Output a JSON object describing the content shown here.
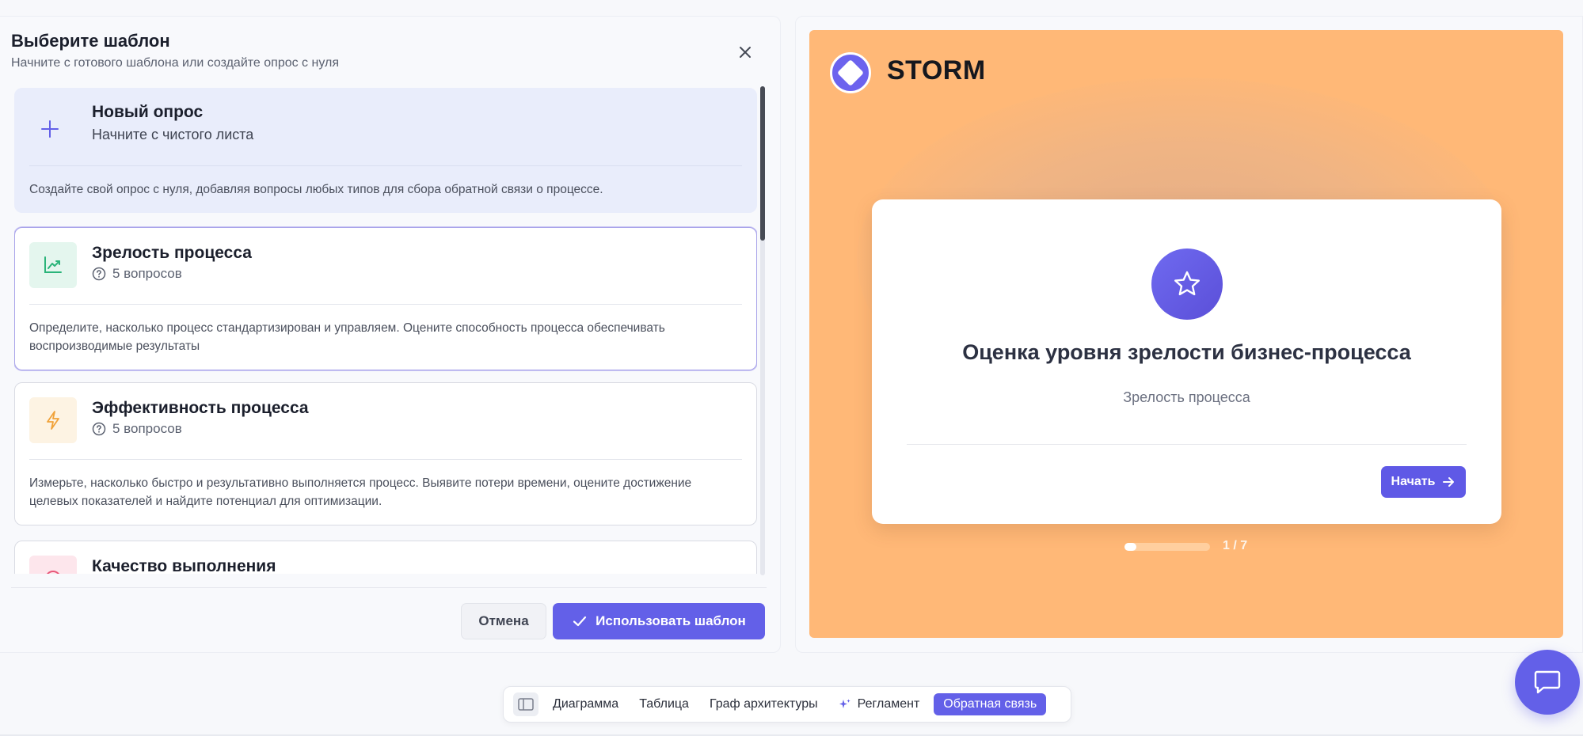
{
  "dialog": {
    "title": "Выберите шаблон",
    "subtitle": "Начните с готового шаблона или создайте опрос с нуля",
    "cancel_label": "Отмена",
    "use_label": "Использовать шаблон"
  },
  "templates": [
    {
      "title": "Новый опрос",
      "subtitle": "Начните с чистого листа",
      "description": "Создайте свой опрос с нуля, добавляя вопросы любых типов для сбора обратной связи о процессе.",
      "icon": "plus-icon"
    },
    {
      "title": "Зрелость процесса",
      "meta": "5 вопросов",
      "description": "Определите, насколько процесс стандартизирован и управляем. Оцените способность процесса обеспечивать воспроизводимые результаты",
      "icon": "trend-chart-icon",
      "selected": true
    },
    {
      "title": "Эффективность процесса",
      "meta": "5 вопросов",
      "description": "Измерьте, насколько быстро и результативно выполняется процесс. Выявите потери времени, оцените достижение целевых показателей и найдите потенциал для оптимизации.",
      "icon": "lightning-icon"
    },
    {
      "title": "Качество выполнения",
      "icon": "target-icon"
    }
  ],
  "preview": {
    "brand": "STORM",
    "survey_title": "Оценка уровня зрелости бизнес-процесса",
    "survey_subtitle": "Зрелость процесса",
    "start_label": "Начать",
    "progress_label": "1 / 7",
    "progress_fraction": 0.143,
    "background_color": "#ffb877",
    "accent_color": "#6360e8"
  },
  "toolbar": {
    "items": [
      "Диаграмма",
      "Таблица",
      "Граф архитектуры",
      "Регламент",
      "Обратная связь"
    ],
    "active": "Обратная связь"
  }
}
